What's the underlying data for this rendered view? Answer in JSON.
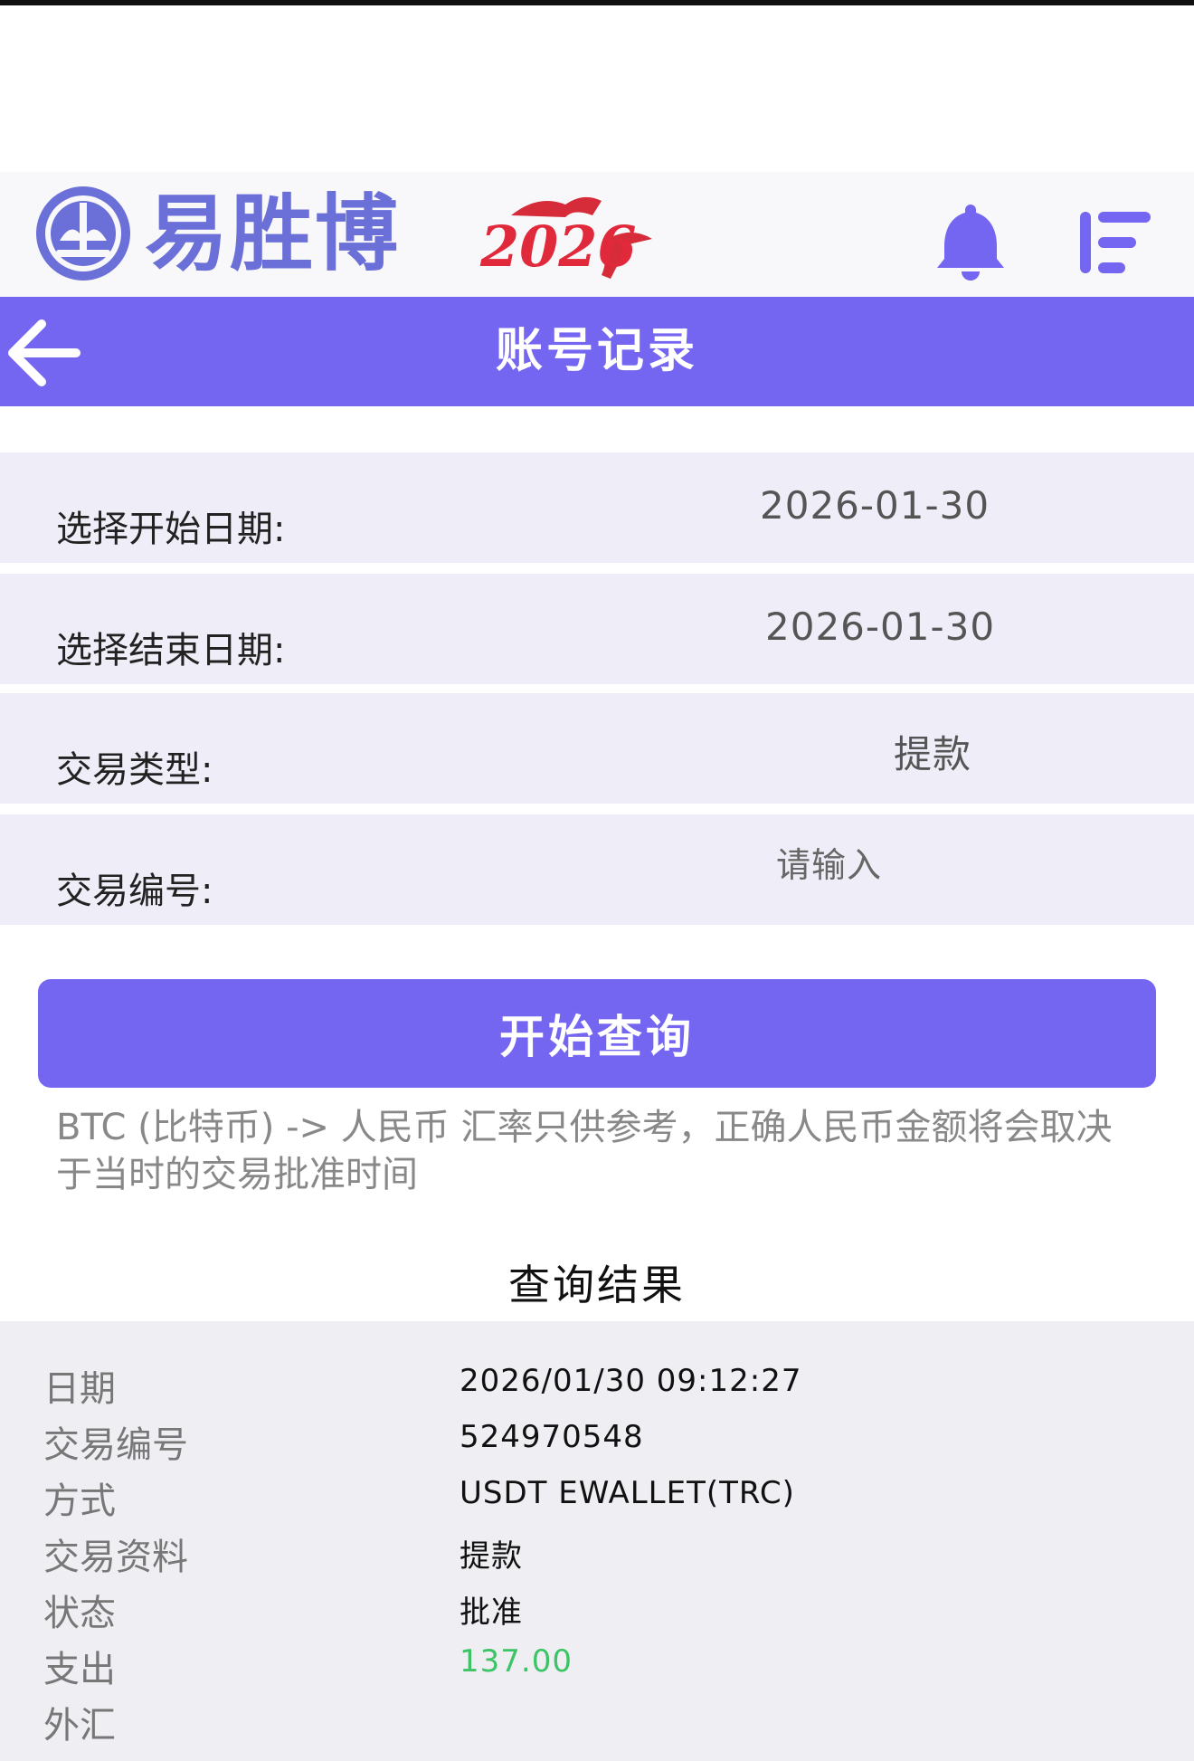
{
  "header": {
    "brand_name": "易胜博",
    "year_badge": "2026"
  },
  "titlebar": {
    "title": "账号记录"
  },
  "form": {
    "start_date": {
      "label": "选择开始日期:",
      "value": "2026-01-30"
    },
    "end_date": {
      "label": "选择结束日期:",
      "value": "2026-01-30"
    },
    "txn_type": {
      "label": "交易类型:",
      "value": "提款"
    },
    "txn_id": {
      "label": "交易编号:",
      "placeholder": "请输入"
    }
  },
  "query_button": "开始查询",
  "note": "BTC (比特币) -> 人民币 汇率只供参考，正确人民币金额将会取决于当时的交易批准时间",
  "results": {
    "title": "查询结果",
    "rows": [
      {
        "label": "日期",
        "value": "2026/01/30 09:12:27"
      },
      {
        "label": "交易编号",
        "value": "524970548"
      },
      {
        "label": "方式",
        "value": "USDT EWALLET(TRC)"
      },
      {
        "label": "交易资料",
        "value": "提款"
      },
      {
        "label": "状态",
        "value": "批准"
      },
      {
        "label": "支出",
        "value": "137.00"
      },
      {
        "label": "外汇",
        "value": ""
      }
    ]
  },
  "colors": {
    "primary": "#7466f1",
    "brand_text": "#6b70d8",
    "row_bg": "#efeef8",
    "amount_green": "#3cc466"
  },
  "icons": {
    "logo": "emblem-logo-icon",
    "bell": "bell-icon",
    "menu": "menu-icon",
    "back": "back-arrow-icon"
  }
}
